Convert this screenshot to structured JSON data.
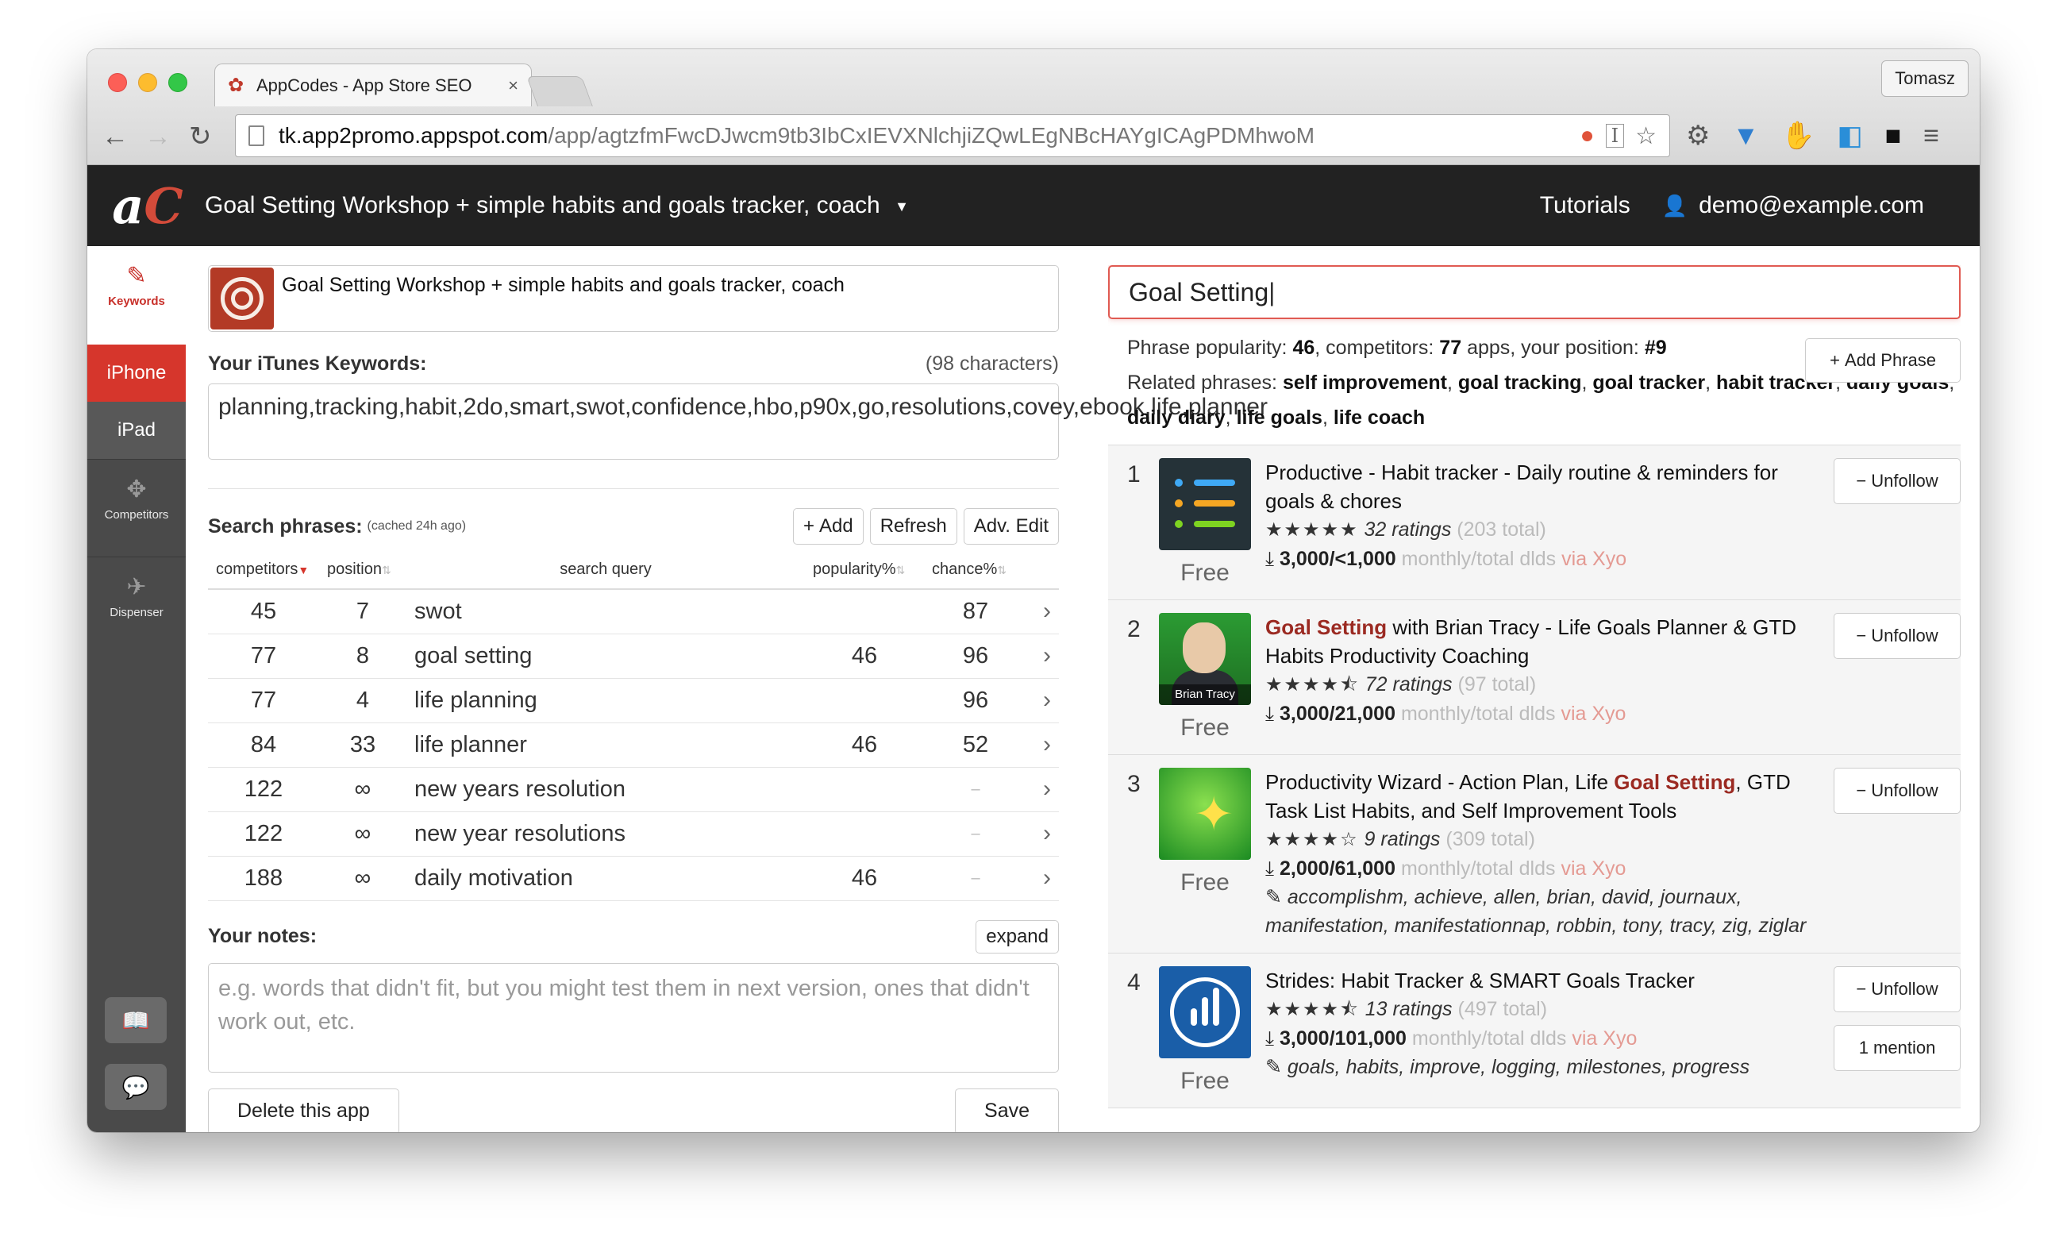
{
  "browser": {
    "tab_title": "AppCodes - App Store SEO",
    "tab_close": "×",
    "profile_name": "Tomasz",
    "url_host": "tk.app2promo.appspot.com",
    "url_path": "/app/agtzfmFwcDJwcm9tb3IbCxIEVXNlchjiZQwLEgNBcHAYgICAgPDMhwoM"
  },
  "header": {
    "logo_a": "a",
    "logo_c": "C",
    "app_title": "Goal Setting Workshop + simple habits and goals tracker, coach",
    "tutorials": "Tutorials",
    "user_email": "demo@example.com"
  },
  "sidebar": {
    "keywords": "Keywords",
    "iphone": "iPhone",
    "ipad": "iPad",
    "competitors": "Competitors",
    "dispenser": "Dispenser"
  },
  "left": {
    "app_name": "Goal Setting Workshop + simple habits and goals tracker, coach",
    "keywords_label": "Your iTunes Keywords:",
    "keywords_count": "(98 characters)",
    "keywords_value": "planning,tracking,habit,2do,smart,swot,confidence,hbo,p90x,go,resolutions,covey,ebook,life,planner",
    "phrases_label": "Search phrases:",
    "phrases_cached": "(cached 24h ago)",
    "add_button": "Add",
    "refresh_button": "Refresh",
    "adv_edit_button": "Adv. Edit",
    "columns": {
      "competitors": "competitors",
      "position": "position",
      "query": "search query",
      "popularity": "popularity%",
      "chance": "chance%"
    },
    "rows": [
      {
        "competitors": "45",
        "position": "7",
        "query": "swot",
        "popularity": "",
        "chance": "87"
      },
      {
        "competitors": "77",
        "position": "8",
        "query": "goal setting",
        "popularity": "46",
        "chance": "96"
      },
      {
        "competitors": "77",
        "position": "4",
        "query": "life planning",
        "popularity": "",
        "chance": "96"
      },
      {
        "competitors": "84",
        "position": "33",
        "query": "life planner",
        "popularity": "46",
        "chance": "52"
      },
      {
        "competitors": "122",
        "position": "∞",
        "query": "new years resolution",
        "popularity": "",
        "chance": "–"
      },
      {
        "competitors": "122",
        "position": "∞",
        "query": "new year resolutions",
        "popularity": "",
        "chance": "–"
      },
      {
        "competitors": "188",
        "position": "∞",
        "query": "daily motivation",
        "popularity": "46",
        "chance": "–"
      }
    ],
    "notes_label": "Your notes:",
    "expand_button": "expand",
    "notes_placeholder": "e.g. words that didn't fit, but you might test them in next version, ones that didn't work out, etc.",
    "delete_button": "Delete this app",
    "save_button": "Save"
  },
  "right": {
    "search_value": "Goal Setting",
    "stats": {
      "popularity_label": "Phrase popularity:",
      "popularity": "46",
      "competitors_label": ", competitors:",
      "competitors": "77",
      "apps_label": "apps, your position:",
      "position": "#9"
    },
    "related_label": "Related phrases:",
    "related": [
      "self improvement",
      "goal tracking",
      "goal tracker",
      "habit tracker",
      "daily goals",
      "daily diary",
      "life goals",
      "life coach"
    ],
    "add_phrase_button": "Add Phrase",
    "competitors": [
      {
        "rank": "1",
        "name_pre": "",
        "name_hl": "",
        "name_post": "Productive - Habit tracker - Daily routine & reminders for goals & chores",
        "rating_count": "32 ratings",
        "total": "(203 total)",
        "downloads": "3,000/<1,000",
        "keywords": "",
        "price": "Free",
        "unfollow": "Unfollow",
        "mention": ""
      },
      {
        "rank": "2",
        "name_pre": "",
        "name_hl": "Goal Setting",
        "name_post": " with Brian Tracy - Life Goals Planner & GTD Habits Productivity Coaching",
        "rating_count": "72 ratings",
        "total": "(97 total)",
        "downloads": "3,000/21,000",
        "keywords": "",
        "price": "Free",
        "unfollow": "Unfollow",
        "mention": ""
      },
      {
        "rank": "3",
        "name_pre": "Productivity Wizard - Action Plan, Life ",
        "name_hl": "Goal Setting",
        "name_post": ", GTD Task List Habits, and Self Improvement Tools",
        "rating_count": "9 ratings",
        "total": "(309 total)",
        "downloads": "2,000/61,000",
        "keywords": "accomplishm, achieve, allen, brian, david, journaux, manifestation, manifestationnap, robbin, tony, tracy, zig, ziglar",
        "price": "Free",
        "unfollow": "Unfollow",
        "mention": ""
      },
      {
        "rank": "4",
        "name_pre": "Strides: Habit Tracker & SMART Goals Tracker",
        "name_hl": "",
        "name_post": "",
        "rating_count": "13 ratings",
        "total": "(497 total)",
        "downloads": "3,000/101,000",
        "keywords": "goals, habits, improve, logging, milestones, progress",
        "price": "Free",
        "unfollow": "Unfollow",
        "mention": "1 mention"
      }
    ],
    "dl_suffix": "monthly/total dlds",
    "via": "via Xyo",
    "brian_tag": "Brian Tracy"
  },
  "colors": {
    "accent_red": "#d6362c",
    "header_bg": "#222222",
    "sidebar_bg": "#4a4a4a",
    "highlight": "#9b2a22"
  }
}
